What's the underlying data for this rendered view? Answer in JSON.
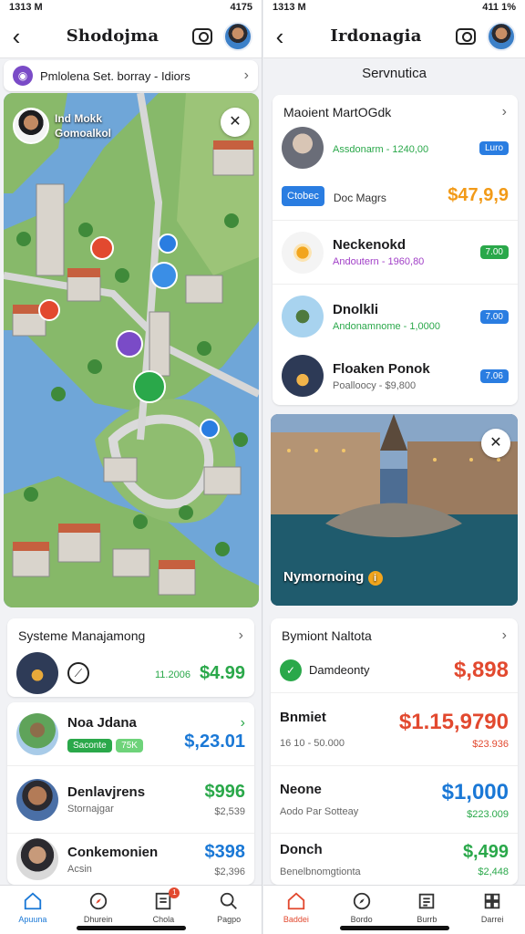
{
  "left": {
    "status": {
      "time": "1313 M",
      "right": "4175"
    },
    "nav": {
      "title": "Shodojma"
    },
    "banner": {
      "text": "Pmlolena Set. borray - Idiors"
    },
    "map": {
      "overlay_name_line1": "Ind Mokk",
      "overlay_name_line2": "Gomoalkol"
    },
    "list_header": "Systeme Manajamong",
    "rows": [
      {
        "title": "",
        "sub": "11.2006",
        "price": "$4.99",
        "color": "green"
      },
      {
        "title": "Noa Jdana",
        "sub": "",
        "pill": "Saconte",
        "pill2": "75K",
        "price": "$,23.01",
        "color": "blue"
      },
      {
        "title": "Denlavjrens",
        "sub": "Stornajgar",
        "price": "$996",
        "price2": "$2,539",
        "color": "green"
      },
      {
        "title": "Conkemonien",
        "sub": "Acsin",
        "price": "$398",
        "price2": "$2,396",
        "color": "blue"
      }
    ],
    "tabs": [
      "Apuuna",
      "Dhurein",
      "Chola",
      "Pagpo"
    ],
    "tab_badge": "1"
  },
  "right": {
    "status": {
      "time": "1313 M",
      "right": "411 1%"
    },
    "nav": {
      "title": "Irdonagia"
    },
    "section_title": "Servnutica",
    "card_header": "Maoient MartOGdk",
    "items": [
      {
        "title": "",
        "sub": "Assdonarm - 1240,00",
        "pill": "Luro",
        "pill_color": "blue",
        "sub_color": "green"
      },
      {
        "title": "Doc Magrs",
        "sub": "",
        "btn": "Ctobec",
        "price": "$47,9,9",
        "price_color": "orange"
      },
      {
        "title": "Neckenokd",
        "sub": "Andoutern - 1960,80",
        "pill": "7.00",
        "pill_color": "green",
        "sub_color": "purple"
      },
      {
        "title": "Dnolkli",
        "sub": "Andonamnome - 1,0000",
        "pill": "7.00",
        "pill_color": "blue",
        "sub_color": "green"
      },
      {
        "title": "Floaken Ponok",
        "sub": "Poalloocy - $9,800",
        "pill": "7.06",
        "pill_color": "blue",
        "sub_color": "gray"
      }
    ],
    "photo_caption": "Nymornoing",
    "list_header": "Bymiont Naltota",
    "rows": [
      {
        "title": "Damdeonty",
        "sub": "",
        "price": "$,898",
        "color": "red"
      },
      {
        "title": "Bnmiet",
        "sub": "16 10 - 50.000",
        "price": "$1.15,9790",
        "price2": "$23.936",
        "color": "red"
      },
      {
        "title": "Neone",
        "sub": "Aodo Par Sotteay",
        "price": "$1,000",
        "price2": "$223.009",
        "color": "blue"
      },
      {
        "title": "Donch",
        "sub": "Benelbnomgtionta",
        "price": "$,499",
        "price2": "$2,448",
        "color": "green"
      }
    ],
    "tabs": [
      "Baddei",
      "Bordo",
      "Burrb",
      "Darrei"
    ]
  }
}
